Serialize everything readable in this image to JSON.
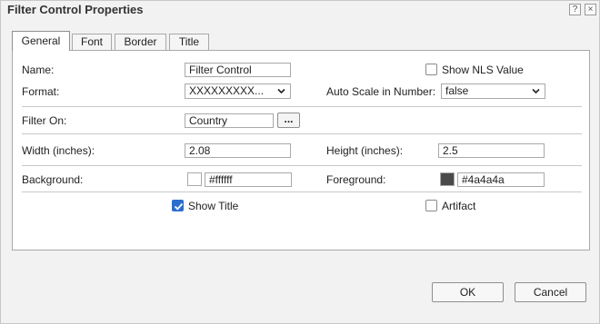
{
  "dialog": {
    "title": "Filter Control Properties",
    "help_label": "?",
    "close_label": "×"
  },
  "tabs": [
    {
      "label": "General",
      "active": true
    },
    {
      "label": "Font",
      "active": false
    },
    {
      "label": "Border",
      "active": false
    },
    {
      "label": "Title",
      "active": false
    }
  ],
  "general": {
    "name_label": "Name:",
    "name_value": "Filter Control",
    "show_nls_label": "Show NLS Value",
    "show_nls_checked": false,
    "format_label": "Format:",
    "format_value": "XXXXXXXXX...",
    "auto_scale_label": "Auto Scale in Number:",
    "auto_scale_value": "false",
    "filter_on_label": "Filter On:",
    "filter_on_value": "Country",
    "browse_label": "...",
    "width_label": "Width (inches):",
    "width_value": "2.08",
    "height_label": "Height (inches):",
    "height_value": "2.5",
    "background_label": "Background:",
    "background_value": "#ffffff",
    "background_color": "#ffffff",
    "foreground_label": "Foreground:",
    "foreground_value": "#4a4a4a",
    "foreground_color": "#4a4a4a",
    "show_title_label": "Show Title",
    "show_title_checked": true,
    "artifact_label": "Artifact",
    "artifact_checked": false
  },
  "footer": {
    "ok_label": "OK",
    "cancel_label": "Cancel"
  },
  "colors": {
    "accent": "#2a6fcf"
  }
}
